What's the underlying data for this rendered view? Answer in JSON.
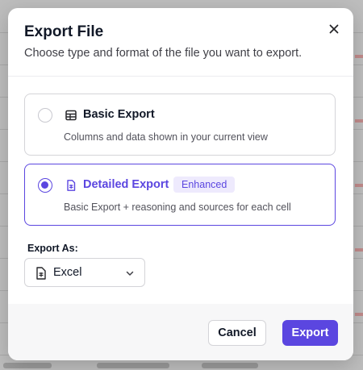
{
  "dialog": {
    "title": "Export File",
    "subtitle": "Choose type and format of the file you want to export.",
    "close_icon": "close-icon"
  },
  "options": [
    {
      "label": "Basic Export",
      "description": "Columns and data shown in your current view",
      "icon": "table-icon",
      "selected": false
    },
    {
      "label": "Detailed Export",
      "badge": "Enhanced",
      "description": "Basic Export + reasoning and sources for each cell",
      "icon": "file-spreadsheet-icon",
      "selected": true
    }
  ],
  "export_as": {
    "label": "Export As:",
    "value": "Excel",
    "icon": "file-spreadsheet-icon"
  },
  "footer": {
    "cancel_label": "Cancel",
    "export_label": "Export"
  },
  "colors": {
    "accent": "#5b46e0",
    "badge_bg": "#eeeafd"
  }
}
